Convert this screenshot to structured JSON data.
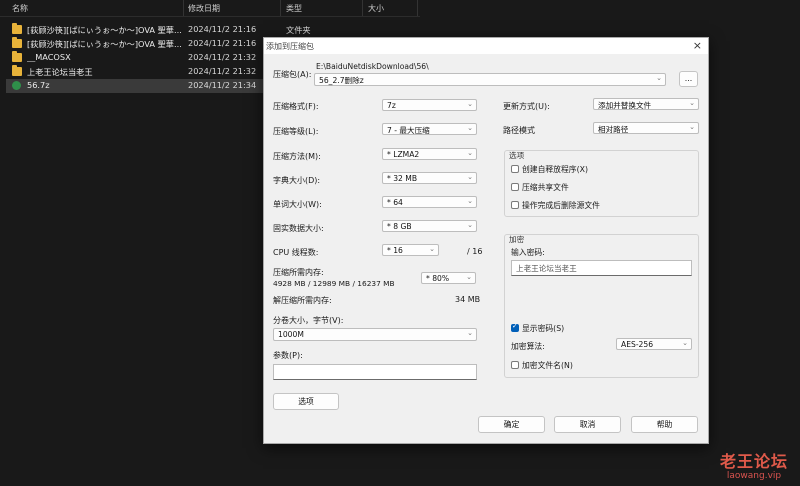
{
  "explorer": {
    "columns": {
      "name": "名称",
      "date": "修改日期",
      "type": "类型",
      "size": "大小"
    },
    "rows": [
      {
        "name": "[荻顾沙筷][ばにぃうぉ～か～]OVA 聖華...",
        "date": "2024/11/2 21:16",
        "type": "文件夹",
        "icon": "folder-icon"
      },
      {
        "name": "[荻顾沙筷][ばにぃうぉ～か～]OVA 聖華...",
        "date": "2024/11/2 21:16",
        "type": "",
        "icon": "folder-icon"
      },
      {
        "name": "__MACOSX",
        "date": "2024/11/2 21:32",
        "type": "",
        "icon": "folder-icon"
      },
      {
        "name": "上老王论坛当老王",
        "date": "2024/11/2 21:32",
        "type": "",
        "icon": "folder-icon"
      },
      {
        "name": "56.7z",
        "date": "2024/11/2 21:34",
        "type": "",
        "icon": "archive-icon"
      }
    ]
  },
  "dialog": {
    "title": "添加到压缩包",
    "close": "×",
    "archive": {
      "label": "压缩包(A):",
      "path": "E:\\BaiduNetdiskDownload\\56\\",
      "filename": "56_2.7删除z",
      "browse": "..."
    },
    "left": {
      "format": {
        "label": "压缩格式(F):",
        "value": "7z"
      },
      "level": {
        "label": "压缩等级(L):",
        "value": "7 - 最大压缩"
      },
      "method": {
        "label": "压缩方法(M):",
        "value": "*  LZMA2"
      },
      "dict": {
        "label": "字典大小(D):",
        "value": "*  32 MB"
      },
      "word": {
        "label": "单词大小(W):",
        "value": "*  64"
      },
      "solid": {
        "label": "固实数据大小:",
        "value": "*  8 GB"
      },
      "threads": {
        "label": "CPU 线程数:",
        "value": "*  16",
        "max": "/ 16"
      },
      "memory": {
        "label": "压缩所需内存:",
        "detail": "4928 MB / 12989 MB / 16237 MB",
        "value": "* 80%"
      },
      "decompress": {
        "label": "解压缩所需内存:",
        "value": "34 MB"
      },
      "split": {
        "label": "分卷大小，字节(V):",
        "value": "1000M"
      },
      "params": {
        "label": "参数(P):",
        "value": ""
      },
      "options_button": "选项"
    },
    "right": {
      "update": {
        "label": "更新方式(U):",
        "value": "添加并替换文件"
      },
      "pathmode": {
        "label": "路径模式",
        "value": "相对路径"
      },
      "options": {
        "title": "选项",
        "sfx": "创建自释放程序(X)",
        "shared": "压缩共享文件",
        "delete": "操作完成后删除源文件"
      },
      "encryption": {
        "title": "加密",
        "password_label": "输入密码:",
        "password": "上老王论坛当老王",
        "show_password": "显示密码(S)",
        "method_label": "加密算法:",
        "method": "AES-256",
        "encrypt_names": "加密文件名(N)"
      }
    },
    "buttons": {
      "ok": "确定",
      "cancel": "取消",
      "help": "帮助"
    }
  },
  "watermark": {
    "big": "老王论坛",
    "small": "laowang.vip"
  }
}
